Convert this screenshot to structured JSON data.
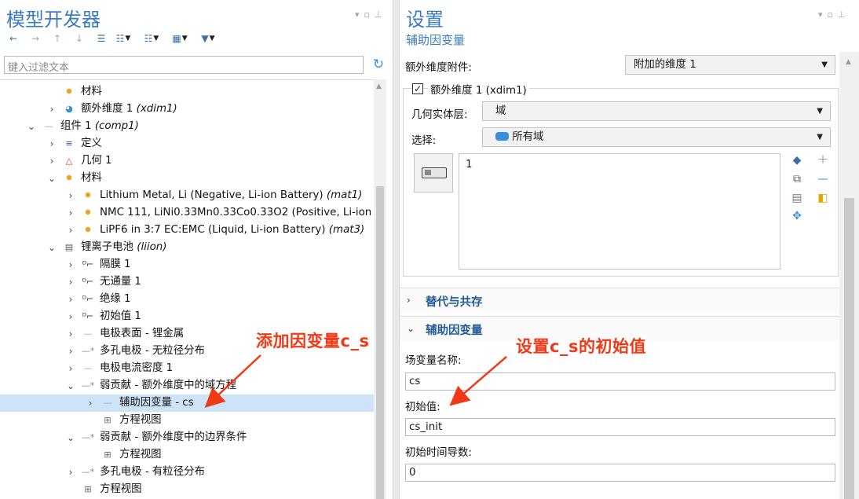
{
  "left": {
    "title": "模型开发器",
    "filter_placeholder": "键入过滤文本",
    "tree": [
      {
        "indent": 0,
        "expander": "",
        "icon": "material-icon",
        "label": "材料",
        "tag": ""
      },
      {
        "indent": 0,
        "expander": "›",
        "icon": "extra-dimension-icon",
        "label": "额外维度 1 ",
        "tag": "(xdim1)"
      },
      {
        "indent": -1,
        "expander": "⌄",
        "icon": "component-icon",
        "label": "组件 1 ",
        "tag": "(comp1)"
      },
      {
        "indent": 0,
        "expander": "›",
        "icon": "definitions-icon",
        "label": "定义",
        "tag": ""
      },
      {
        "indent": 0,
        "expander": "›",
        "icon": "geometry-icon",
        "label": "几何 1",
        "tag": ""
      },
      {
        "indent": 0,
        "expander": "⌄",
        "icon": "materials-icon",
        "label": "材料",
        "tag": ""
      },
      {
        "indent": 1,
        "expander": "›",
        "icon": "material-icon",
        "label": "Lithium Metal, Li (Negative, Li-ion Battery) ",
        "tag": "(mat1)"
      },
      {
        "indent": 1,
        "expander": "›",
        "icon": "material-icon",
        "label": "NMC 111, LiNi0.33Mn0.33Co0.33O2 (Positive, Li-ion",
        "tag": ""
      },
      {
        "indent": 1,
        "expander": "›",
        "icon": "material-icon",
        "label": "LiPF6 in 3:7 EC:EMC (Liquid, Li-ion Battery) ",
        "tag": "(mat3)"
      },
      {
        "indent": 0,
        "expander": "⌄",
        "icon": "battery-icon",
        "label": "锂离子电池 ",
        "tag": "(liion)"
      },
      {
        "indent": 1,
        "expander": "›",
        "icon": "boundary-d-icon",
        "label": "隔膜 1",
        "tag": ""
      },
      {
        "indent": 1,
        "expander": "›",
        "icon": "boundary-d-icon",
        "label": "无通量 1",
        "tag": ""
      },
      {
        "indent": 1,
        "expander": "›",
        "icon": "boundary-d-icon",
        "label": "绝缘 1",
        "tag": ""
      },
      {
        "indent": 1,
        "expander": "›",
        "icon": "boundary-d-icon",
        "label": "初始值 1",
        "tag": ""
      },
      {
        "indent": 1,
        "expander": "›",
        "icon": "line-icon",
        "label": "电极表面 - 锂金属",
        "tag": ""
      },
      {
        "indent": 1,
        "expander": "›",
        "icon": "line-star-icon",
        "label": "多孔电极 - 无粒径分布",
        "tag": ""
      },
      {
        "indent": 1,
        "expander": "›",
        "icon": "line-icon",
        "label": "电极电流密度 1",
        "tag": ""
      },
      {
        "indent": 1,
        "expander": "⌄",
        "icon": "line-star-icon",
        "label": "弱贡献 - 额外维度中的域方程",
        "tag": ""
      },
      {
        "indent": 2,
        "expander": "›",
        "icon": "line-icon",
        "label": "辅助因变量 - cs",
        "tag": "",
        "selected": true
      },
      {
        "indent": 2,
        "expander": "",
        "icon": "equation-view-icon",
        "label": "方程视图",
        "tag": ""
      },
      {
        "indent": 1,
        "expander": "⌄",
        "icon": "line-star-icon",
        "label": "弱贡献 - 额外维度中的边界条件",
        "tag": ""
      },
      {
        "indent": 2,
        "expander": "",
        "icon": "equation-view-icon",
        "label": "方程视图",
        "tag": ""
      },
      {
        "indent": 1,
        "expander": "›",
        "icon": "line-star-icon",
        "label": "多孔电极 - 有粒径分布",
        "tag": ""
      },
      {
        "indent": 1,
        "expander": "",
        "icon": "equation-view-icon",
        "label": "方程视图",
        "tag": ""
      }
    ]
  },
  "annotations": {
    "left": "添加因变量c_s",
    "right": "设置c_s的初始值"
  },
  "right": {
    "title": "设置",
    "subtitle": "辅助因变量",
    "attach_label": "额外维度附件:",
    "attach_value": "附加的维度 1",
    "xdim_checkbox_label": "额外维度 1 (xdim1)",
    "geom_level_label": "几何实体层:",
    "geom_level_value": "域",
    "selection_label": "选择:",
    "selection_value": "所有域",
    "selection_list": [
      "1"
    ],
    "sections": {
      "substitution": "替代与共存",
      "auxiliary": "辅助因变量"
    },
    "field_name_label": "场变量名称:",
    "field_name_value": "cs",
    "initial_value_label": "初始值:",
    "initial_value_value": "cs_init",
    "initial_time_deriv_label": "初始时间导数:",
    "initial_time_deriv_value": "0"
  },
  "colors": {
    "title_blue": "#3b7bbf",
    "annotation_red": "#f03a17",
    "selection_bg": "#cfe3f7"
  }
}
